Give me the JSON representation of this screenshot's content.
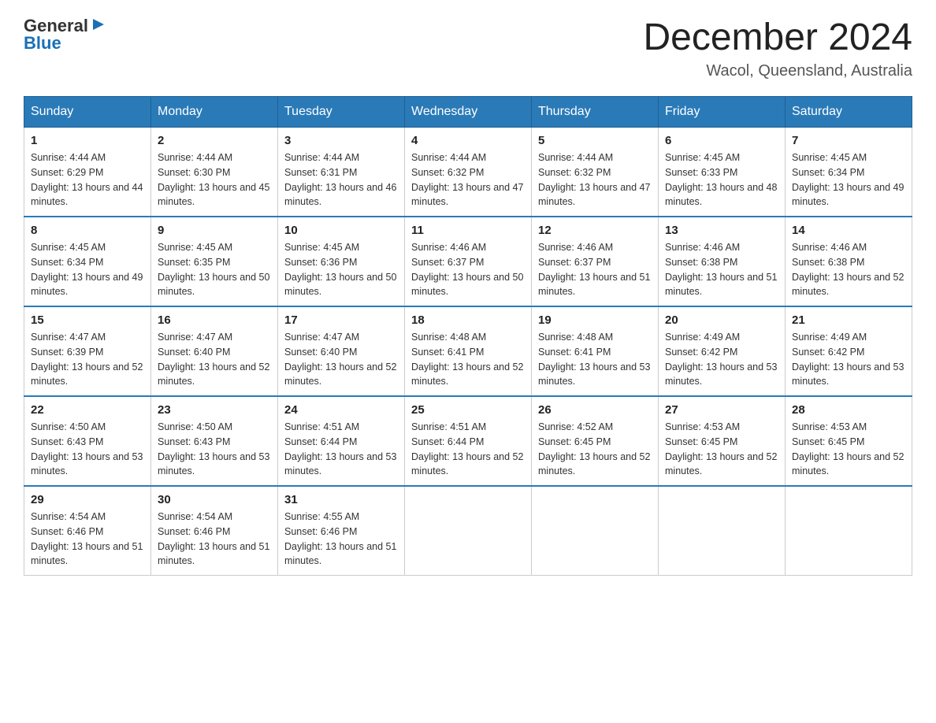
{
  "logo": {
    "general": "General",
    "blue": "Blue"
  },
  "title": "December 2024",
  "location": "Wacol, Queensland, Australia",
  "headers": [
    "Sunday",
    "Monday",
    "Tuesday",
    "Wednesday",
    "Thursday",
    "Friday",
    "Saturday"
  ],
  "weeks": [
    [
      {
        "day": "1",
        "sunrise": "4:44 AM",
        "sunset": "6:29 PM",
        "daylight": "13 hours and 44 minutes."
      },
      {
        "day": "2",
        "sunrise": "4:44 AM",
        "sunset": "6:30 PM",
        "daylight": "13 hours and 45 minutes."
      },
      {
        "day": "3",
        "sunrise": "4:44 AM",
        "sunset": "6:31 PM",
        "daylight": "13 hours and 46 minutes."
      },
      {
        "day": "4",
        "sunrise": "4:44 AM",
        "sunset": "6:32 PM",
        "daylight": "13 hours and 47 minutes."
      },
      {
        "day": "5",
        "sunrise": "4:44 AM",
        "sunset": "6:32 PM",
        "daylight": "13 hours and 47 minutes."
      },
      {
        "day": "6",
        "sunrise": "4:45 AM",
        "sunset": "6:33 PM",
        "daylight": "13 hours and 48 minutes."
      },
      {
        "day": "7",
        "sunrise": "4:45 AM",
        "sunset": "6:34 PM",
        "daylight": "13 hours and 49 minutes."
      }
    ],
    [
      {
        "day": "8",
        "sunrise": "4:45 AM",
        "sunset": "6:34 PM",
        "daylight": "13 hours and 49 minutes."
      },
      {
        "day": "9",
        "sunrise": "4:45 AM",
        "sunset": "6:35 PM",
        "daylight": "13 hours and 50 minutes."
      },
      {
        "day": "10",
        "sunrise": "4:45 AM",
        "sunset": "6:36 PM",
        "daylight": "13 hours and 50 minutes."
      },
      {
        "day": "11",
        "sunrise": "4:46 AM",
        "sunset": "6:37 PM",
        "daylight": "13 hours and 50 minutes."
      },
      {
        "day": "12",
        "sunrise": "4:46 AM",
        "sunset": "6:37 PM",
        "daylight": "13 hours and 51 minutes."
      },
      {
        "day": "13",
        "sunrise": "4:46 AM",
        "sunset": "6:38 PM",
        "daylight": "13 hours and 51 minutes."
      },
      {
        "day": "14",
        "sunrise": "4:46 AM",
        "sunset": "6:38 PM",
        "daylight": "13 hours and 52 minutes."
      }
    ],
    [
      {
        "day": "15",
        "sunrise": "4:47 AM",
        "sunset": "6:39 PM",
        "daylight": "13 hours and 52 minutes."
      },
      {
        "day": "16",
        "sunrise": "4:47 AM",
        "sunset": "6:40 PM",
        "daylight": "13 hours and 52 minutes."
      },
      {
        "day": "17",
        "sunrise": "4:47 AM",
        "sunset": "6:40 PM",
        "daylight": "13 hours and 52 minutes."
      },
      {
        "day": "18",
        "sunrise": "4:48 AM",
        "sunset": "6:41 PM",
        "daylight": "13 hours and 52 minutes."
      },
      {
        "day": "19",
        "sunrise": "4:48 AM",
        "sunset": "6:41 PM",
        "daylight": "13 hours and 53 minutes."
      },
      {
        "day": "20",
        "sunrise": "4:49 AM",
        "sunset": "6:42 PM",
        "daylight": "13 hours and 53 minutes."
      },
      {
        "day": "21",
        "sunrise": "4:49 AM",
        "sunset": "6:42 PM",
        "daylight": "13 hours and 53 minutes."
      }
    ],
    [
      {
        "day": "22",
        "sunrise": "4:50 AM",
        "sunset": "6:43 PM",
        "daylight": "13 hours and 53 minutes."
      },
      {
        "day": "23",
        "sunrise": "4:50 AM",
        "sunset": "6:43 PM",
        "daylight": "13 hours and 53 minutes."
      },
      {
        "day": "24",
        "sunrise": "4:51 AM",
        "sunset": "6:44 PM",
        "daylight": "13 hours and 53 minutes."
      },
      {
        "day": "25",
        "sunrise": "4:51 AM",
        "sunset": "6:44 PM",
        "daylight": "13 hours and 52 minutes."
      },
      {
        "day": "26",
        "sunrise": "4:52 AM",
        "sunset": "6:45 PM",
        "daylight": "13 hours and 52 minutes."
      },
      {
        "day": "27",
        "sunrise": "4:53 AM",
        "sunset": "6:45 PM",
        "daylight": "13 hours and 52 minutes."
      },
      {
        "day": "28",
        "sunrise": "4:53 AM",
        "sunset": "6:45 PM",
        "daylight": "13 hours and 52 minutes."
      }
    ],
    [
      {
        "day": "29",
        "sunrise": "4:54 AM",
        "sunset": "6:46 PM",
        "daylight": "13 hours and 51 minutes."
      },
      {
        "day": "30",
        "sunrise": "4:54 AM",
        "sunset": "6:46 PM",
        "daylight": "13 hours and 51 minutes."
      },
      {
        "day": "31",
        "sunrise": "4:55 AM",
        "sunset": "6:46 PM",
        "daylight": "13 hours and 51 minutes."
      },
      null,
      null,
      null,
      null
    ]
  ]
}
